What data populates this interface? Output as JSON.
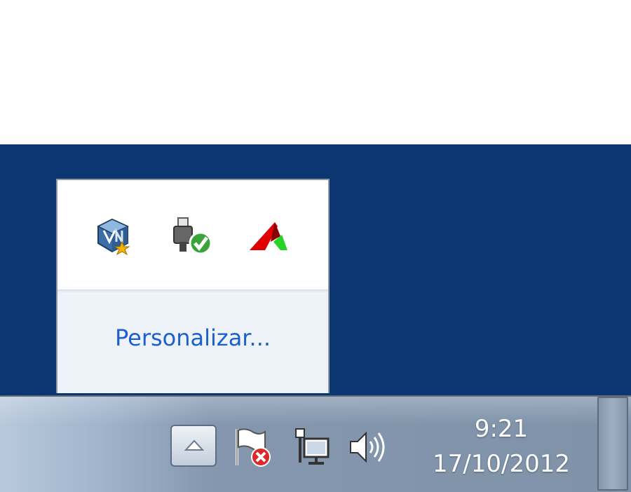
{
  "flyout": {
    "icons": [
      {
        "name": "virtualbox-icon"
      },
      {
        "name": "usb-safely-remove-icon"
      },
      {
        "name": "red-green-a-app-icon"
      }
    ],
    "customize_link": "Personalizar..."
  },
  "taskbar": {
    "show_hidden_button": "chevron-up-icon",
    "icons": [
      "action-center-flag-error-icon",
      "network-icon",
      "volume-icon"
    ],
    "clock": {
      "time": "9:21",
      "date": "17/10/2012"
    }
  },
  "colors": {
    "desktop": "#0b3672",
    "link": "#1c5fcf",
    "taskbar": "#8497ae"
  }
}
